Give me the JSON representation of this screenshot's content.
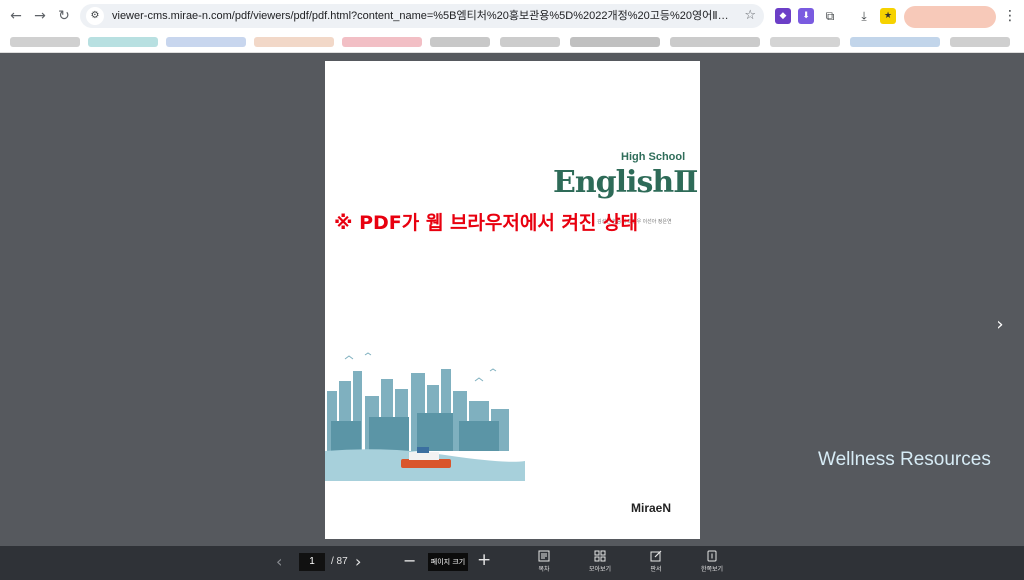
{
  "browser": {
    "url": "viewer-cms.mirae-n.com/pdf/viewers/pdf/pdf.html?content_name=%5B엠티처%20홍보관용%5D%2022개정%20고등%20영어Ⅱ%20교과서%20펼침..."
  },
  "document": {
    "series": "High School",
    "title": "EnglishⅡ",
    "authors": "김성연 한승리 최정우 이선아 정은연",
    "publisher": "MiraeN"
  },
  "overlay_note": "※ PDF가 웹 브라우저에서 켜진 상태",
  "watermark": "Wellness Resources",
  "pager": {
    "current_page": "1",
    "total": "/ 87",
    "zoom_label": "페이지 크기"
  },
  "tools": [
    {
      "label": "목차",
      "icon": "toc-icon"
    },
    {
      "label": "모아보기",
      "icon": "grid-icon"
    },
    {
      "label": "판서",
      "icon": "pen-icon"
    },
    {
      "label": "한쪽보기",
      "icon": "single-page-icon"
    }
  ],
  "colors": {
    "viewer_bg": "#56595e",
    "bottombar_bg": "#2f3237",
    "title_green": "#2e6b58",
    "note_red": "#e8000f"
  }
}
